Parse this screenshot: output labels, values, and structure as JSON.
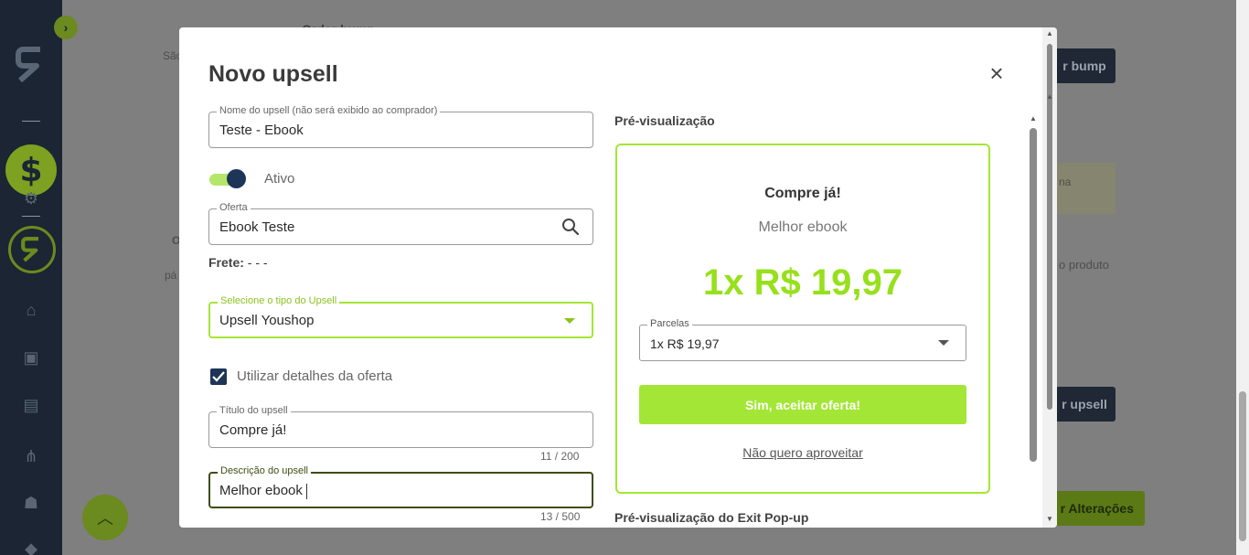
{
  "background": {
    "texts": [
      "Order bump",
      "São",
      "O",
      "pá",
      "na",
      "o produto"
    ],
    "buttons": [
      "r bump",
      "r upsell"
    ],
    "save_button": "r Alterações"
  },
  "modal": {
    "title": "Novo upsell",
    "close": "×",
    "fields": {
      "name": {
        "label": "Nome do upsell (não será exibido ao comprador)",
        "value": "Teste - Ebook"
      },
      "active": {
        "label": "Ativo",
        "checked": true
      },
      "offer": {
        "label": "Oferta",
        "value": "Ebook Teste"
      },
      "shipping": {
        "label": "Frete:",
        "value": "- - -"
      },
      "upsell_type": {
        "label": "Selecione o tipo do Upsell",
        "value": "Upsell Youshop"
      },
      "use_offer_details": {
        "label": "Utilizar detalhes da oferta",
        "checked": true
      },
      "upsell_title": {
        "label": "Título do upsell",
        "value": "Compre já!",
        "counter": "11 / 200"
      },
      "upsell_description": {
        "label": "Descrição do upsell",
        "value": "Melhor ebook",
        "counter": "13 / 500"
      }
    },
    "preview": {
      "label": "Pré-visualização",
      "card_title": "Compre já!",
      "card_description": "Melhor ebook",
      "price": "1x R$ 19,97",
      "installments_label": "Parcelas",
      "installments_value": "1x R$ 19,97",
      "accept_button": "Sim, aceitar oferta!",
      "decline_link": "Não quero aproveitar",
      "exit_popup_label": "Pré-visualização do Exit Pop-up"
    }
  },
  "colors": {
    "accent": "#a3e635",
    "price": "#97e01c",
    "navy": "#1d3557",
    "sidebar": "#1b2533"
  }
}
